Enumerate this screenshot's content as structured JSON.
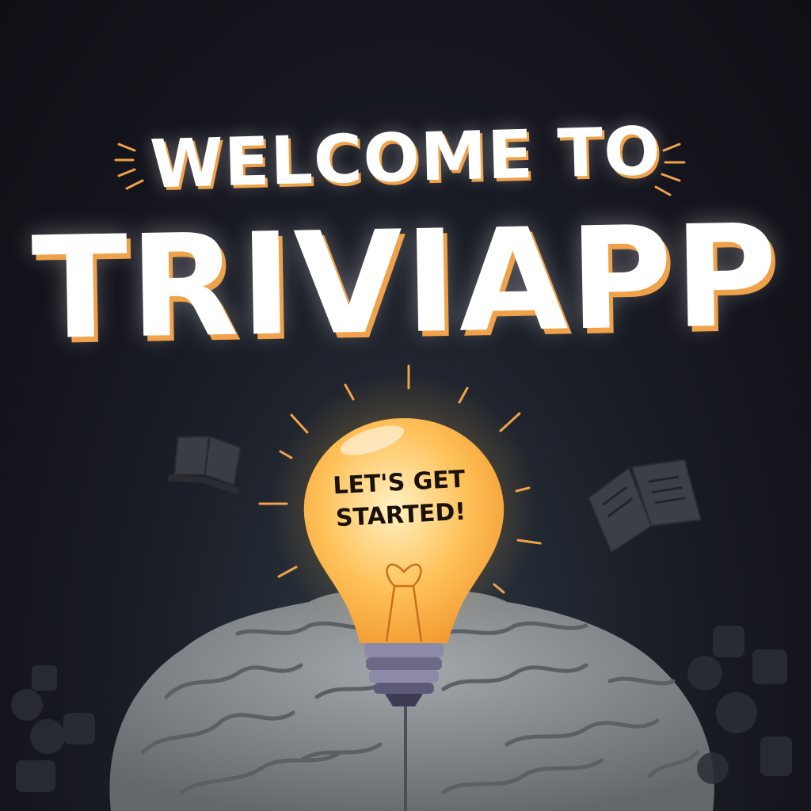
{
  "header": {
    "line1": "WELCOME TO",
    "line2": "TRIVIAPP"
  },
  "cta": {
    "line1": "LET'S GET",
    "line2": "STARTED!"
  },
  "colors": {
    "accent": "#f0a24a",
    "bulb": "#ffc25a",
    "brain": "#8a9094",
    "background": "#14141c"
  },
  "icons": [
    "lightbulb-icon",
    "brain-illustration",
    "open-book-icon",
    "book-icon"
  ]
}
